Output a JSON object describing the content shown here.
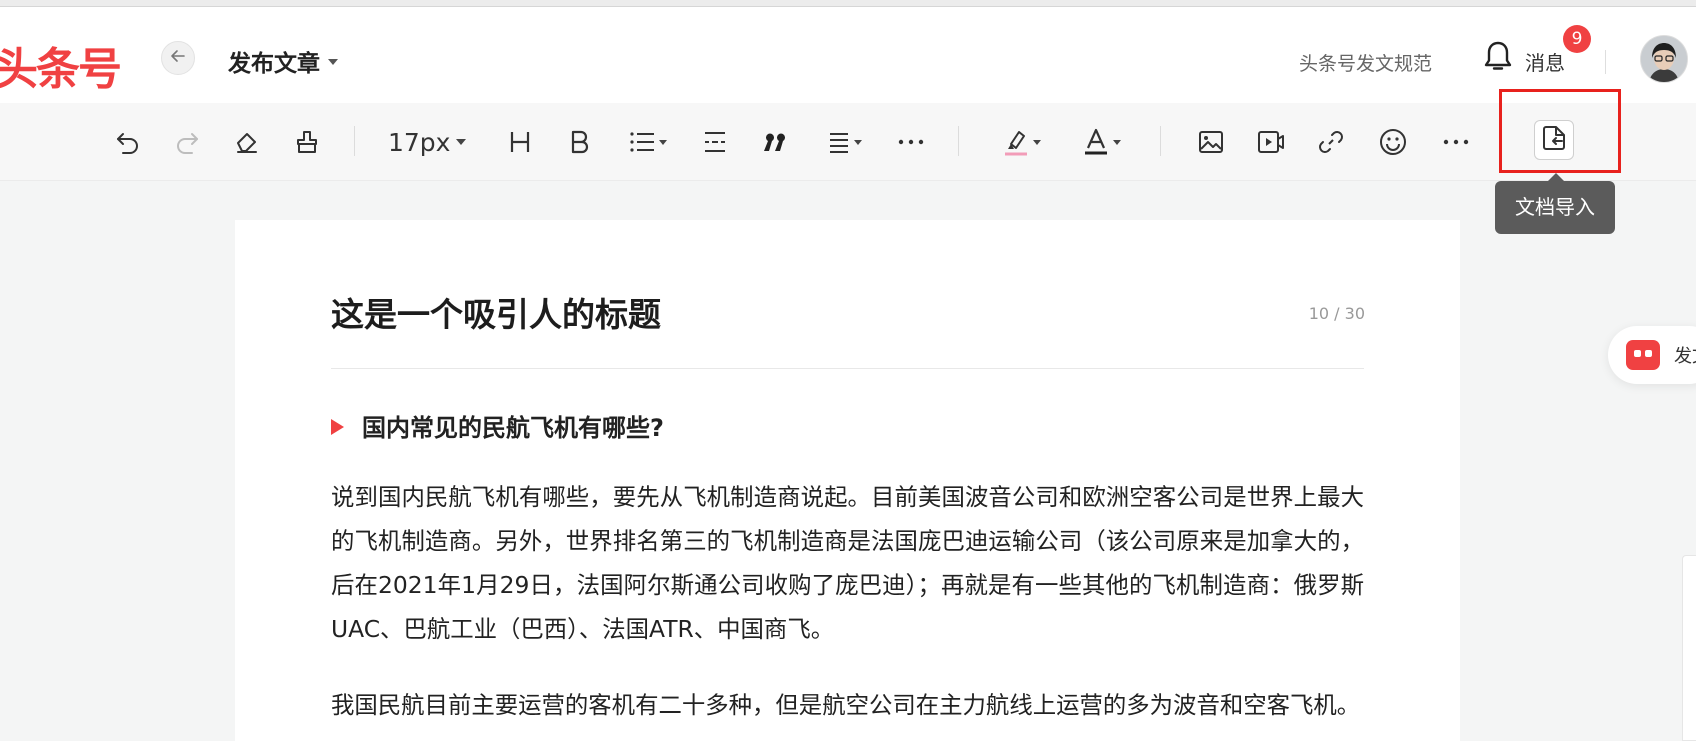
{
  "header": {
    "logo": "头条号",
    "page_title": "发布文章",
    "guide_link": "头条号发文规范",
    "messages_label": "消息",
    "messages_count": "9"
  },
  "toolbar": {
    "font_size": "17px",
    "import_tooltip": "文档导入",
    "icons": [
      "undo-icon",
      "redo-icon",
      "eraser-icon",
      "format-painter-icon",
      "heading-icon",
      "bold-icon",
      "list-icon",
      "divider-icon",
      "quote-icon",
      "align-icon",
      "more-icon",
      "highlight-icon",
      "font-color-icon",
      "image-icon",
      "video-icon",
      "link-icon",
      "emoji-icon",
      "more-icon",
      "document-import-icon"
    ]
  },
  "side_widget": {
    "label": "发文"
  },
  "article": {
    "title": "这是一个吸引人的标题",
    "title_count": "10 / 30",
    "subheading": "国内常见的民航飞机有哪些?",
    "paragraphs": [
      "说到国内民航飞机有哪些，要先从飞机制造商说起。目前美国波音公司和欧洲空客公司是世界上最大的飞机制造商。另外，世界排名第三的飞机制造商是法国庞巴迪运输公司（该公司原来是加拿大的，后在2021年1月29日，法国阿尔斯通公司收购了庞巴迪）；再就是有一些其他的飞机制造商：俄罗斯UAC、巴航工业（巴西）、法国ATR、中国商飞。",
      "我国民航目前主要运营的客机有二十多种，但是航空公司在主力航线上运营的多为波音和空客飞机。"
    ]
  },
  "colors": {
    "brand": "#f04142",
    "highlight_box": "#e8211d",
    "tooltip_bg": "#5b5b5b"
  }
}
